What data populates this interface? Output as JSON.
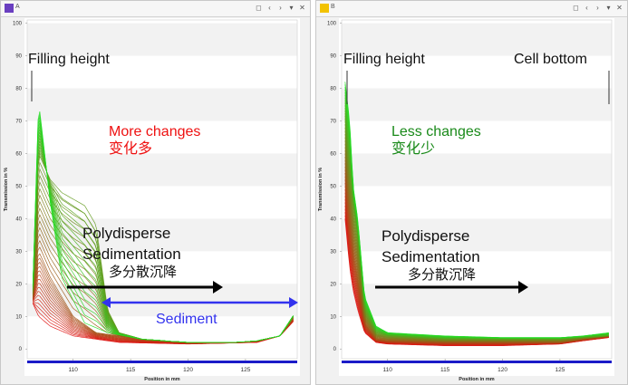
{
  "panels": [
    {
      "id": "A",
      "letter": "A",
      "swatch_color": "#6a3fc0",
      "annotations": {
        "filling": "Filling height",
        "changes_en": "More changes",
        "changes_cn": "变化多",
        "poly1": "Polydisperse",
        "poly2": "Sedimentation",
        "poly_cn": "多分散沉降",
        "sediment": "Sediment"
      }
    },
    {
      "id": "B",
      "letter": "B",
      "swatch_color": "#f2c200",
      "annotations": {
        "filling": "Filling height",
        "cell_bottom": "Cell bottom",
        "changes_en": "Less changes",
        "changes_cn": "变化少",
        "poly1": "Polydisperse",
        "poly2": "Sedimentation",
        "poly_cn": "多分散沉降"
      }
    }
  ],
  "window_controls": [
    "◻",
    "‹",
    "›",
    "▾",
    "✕"
  ],
  "colors": {
    "more_changes": "#ee1111",
    "less_changes": "#1a8a1a",
    "sediment": "#3333ee",
    "profile_start": "#e01010",
    "profile_end": "#22dd22"
  },
  "chart_data": [
    {
      "type": "line",
      "panel": "A",
      "title": "",
      "xlabel": "Position in mm",
      "ylabel": "Transmission in %",
      "xlim": [
        106,
        129.5
      ],
      "ylim": [
        -3,
        101
      ],
      "x_ticks": [
        "110",
        "115",
        "120",
        "125"
      ],
      "y_ticks": [
        "0",
        "10",
        "20",
        "30",
        "40",
        "50",
        "60",
        "70",
        "80",
        "90",
        "100"
      ],
      "series": [
        {
          "values": [
            [
              106.5,
              20
            ],
            [
              107,
              76
            ],
            [
              108,
              45
            ],
            [
              109,
              22
            ],
            [
              111,
              8
            ],
            [
              113,
              5
            ],
            [
              116,
              3
            ],
            [
              120,
              2
            ],
            [
              124,
              2
            ],
            [
              126,
              2.5
            ],
            [
              128,
              4
            ],
            [
              129.3,
              11
            ]
          ]
        },
        {
          "values": [
            [
              106.5,
              18
            ],
            [
              107,
              60
            ],
            [
              108,
              52
            ],
            [
              109,
              48
            ],
            [
              110,
              46
            ],
            [
              111,
              44
            ],
            [
              112,
              38
            ],
            [
              113,
              12
            ],
            [
              114,
              5
            ],
            [
              116,
              3
            ],
            [
              120,
              2
            ],
            [
              124,
              2
            ],
            [
              126,
              2.5
            ],
            [
              128,
              4
            ],
            [
              129.3,
              11
            ]
          ]
        },
        {
          "values": [
            [
              106.5,
              16
            ],
            [
              107,
              30
            ],
            [
              108,
              22
            ],
            [
              110,
              10
            ],
            [
              112,
              5
            ],
            [
              116,
              3
            ],
            [
              120,
              2
            ],
            [
              124,
              2
            ],
            [
              126,
              2.5
            ],
            [
              128,
              4
            ],
            [
              129.3,
              10
            ]
          ]
        },
        {
          "values": [
            [
              106.5,
              14
            ],
            [
              107,
              10
            ],
            [
              108,
              7
            ],
            [
              110,
              4
            ],
            [
              114,
              2
            ],
            [
              120,
              1.5
            ],
            [
              126,
              2
            ],
            [
              128,
              4
            ],
            [
              129.3,
              9
            ]
          ]
        }
      ]
    },
    {
      "type": "line",
      "panel": "B",
      "title": "",
      "xlabel": "Position in mm",
      "ylabel": "Transmission in %",
      "xlim": [
        106,
        129.5
      ],
      "ylim": [
        -3,
        101
      ],
      "x_ticks": [
        "110",
        "115",
        "120",
        "125"
      ],
      "y_ticks": [
        "0",
        "10",
        "20",
        "30",
        "40",
        "50",
        "60",
        "70",
        "80",
        "90",
        "100"
      ],
      "series": [
        {
          "values": [
            [
              106.3,
              82
            ],
            [
              106.7,
              70
            ],
            [
              107,
              50
            ],
            [
              107.4,
              40
            ],
            [
              108,
              16
            ],
            [
              109,
              7
            ],
            [
              110,
              5
            ],
            [
              115,
              4
            ],
            [
              120,
              3.5
            ],
            [
              125,
              3.5
            ],
            [
              127,
              4
            ],
            [
              129.3,
              5
            ]
          ]
        },
        {
          "values": [
            [
              106.3,
              70
            ],
            [
              106.7,
              55
            ],
            [
              107,
              45
            ],
            [
              107.4,
              35
            ],
            [
              108,
              12
            ],
            [
              109,
              5
            ],
            [
              110,
              4
            ],
            [
              115,
              3
            ],
            [
              120,
              3
            ],
            [
              125,
              3
            ],
            [
              127,
              3.5
            ],
            [
              129.3,
              4
            ]
          ]
        },
        {
          "values": [
            [
              106.3,
              55
            ],
            [
              106.7,
              40
            ],
            [
              107,
              30
            ],
            [
              107.4,
              22
            ],
            [
              108,
              8
            ],
            [
              109,
              3
            ],
            [
              110,
              2.5
            ],
            [
              115,
              2
            ],
            [
              120,
              2
            ],
            [
              125,
              2
            ],
            [
              127,
              3
            ],
            [
              129.3,
              4
            ]
          ]
        },
        {
          "values": [
            [
              106.3,
              40
            ],
            [
              106.7,
              25
            ],
            [
              107,
              18
            ],
            [
              107.4,
              12
            ],
            [
              108,
              5
            ],
            [
              109,
              2
            ],
            [
              110,
              1.5
            ],
            [
              115,
              1
            ],
            [
              120,
              1
            ],
            [
              125,
              1.5
            ],
            [
              127,
              2.5
            ],
            [
              129.3,
              3.5
            ]
          ]
        }
      ]
    }
  ]
}
